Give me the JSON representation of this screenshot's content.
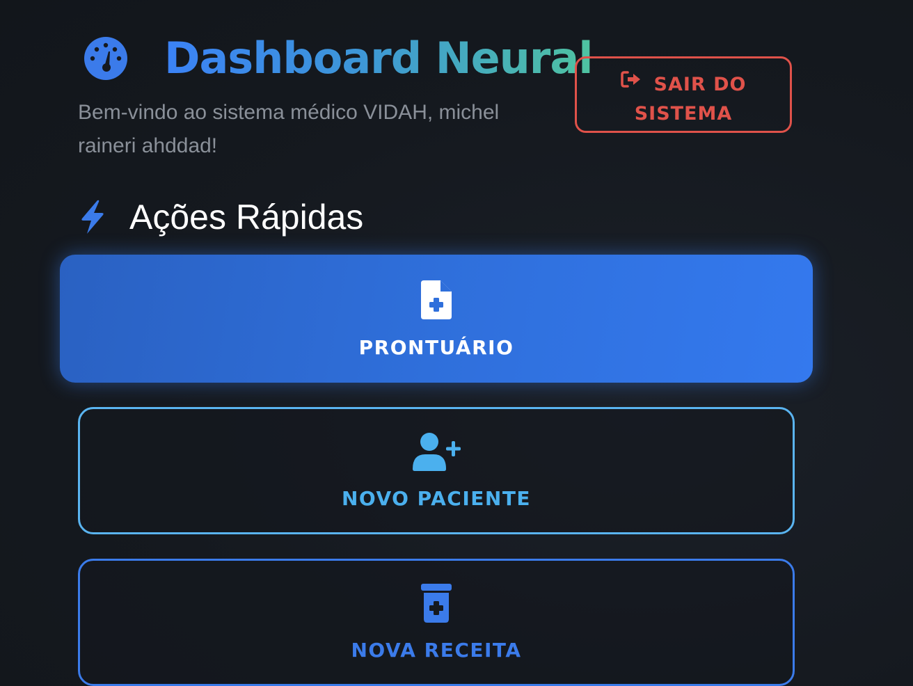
{
  "header": {
    "title": "Dashboard Neural",
    "title_icon": "gauge-icon",
    "subtitle": "Bem-vindo ao sistema médico VIDAH, michel raineri ahddad!",
    "logout_label": "SAIR DO SISTEMA",
    "logout_icon": "sign-out-icon"
  },
  "quick_actions": {
    "title": "Ações Rápidas",
    "icon": "bolt-icon",
    "items": [
      {
        "label": "PRONTUÁRIO",
        "icon": "file-medical-icon",
        "color": "#3479ee"
      },
      {
        "label": "NOVO PACIENTE",
        "icon": "user-plus-icon",
        "color": "#4bb0ee"
      },
      {
        "label": "NOVA RECEITA",
        "icon": "prescription-bottle-icon",
        "color": "#3b7bea"
      }
    ]
  },
  "colors": {
    "background": "#15191f",
    "accent_blue": "#3b82f6",
    "accent_teal": "#4fc3a1",
    "danger": "#e0524a",
    "subtitle_text": "#8a9099"
  }
}
